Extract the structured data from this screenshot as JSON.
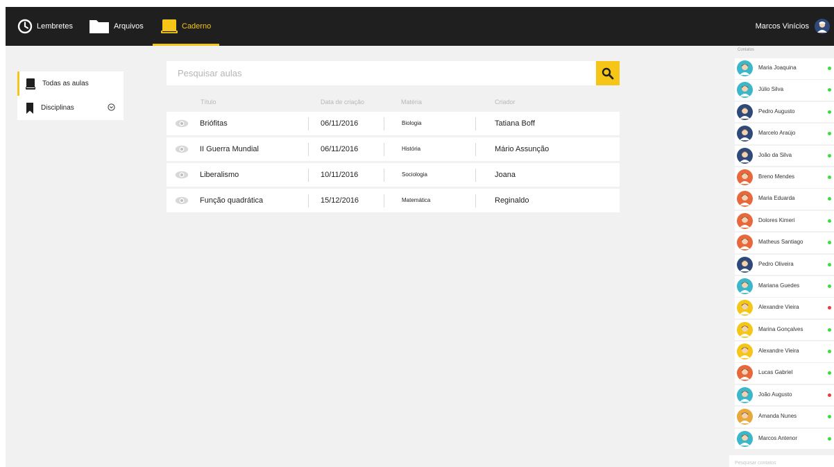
{
  "nav": {
    "items": [
      {
        "label": "Lembretes",
        "icon": "clock-icon"
      },
      {
        "label": "Arquivos",
        "icon": "folder-icon"
      },
      {
        "label": "Caderno",
        "icon": "notebook-icon"
      }
    ],
    "active": "Caderno",
    "accent": "#f5c518"
  },
  "user": {
    "name": "Marcos Vinícios",
    "icon": "avatar"
  },
  "menu": {
    "items": [
      {
        "label": "Todas as aulas",
        "icon": "book-icon",
        "active": true
      },
      {
        "label": "Disciplinas",
        "icon": "bookmark-icon",
        "active": false
      }
    ]
  },
  "search": {
    "placeholder": "Pesquisar aulas",
    "icon": "search-icon"
  },
  "table": {
    "columns": [
      "Título",
      "Data de criação",
      "Matéria",
      "Criador"
    ],
    "rows": [
      {
        "titulo": "Briófitas",
        "data": "06/11/2016",
        "materia": "Biologia",
        "criador": "Tatiana Boff"
      },
      {
        "titulo": "II Guerra Mundial",
        "data": "06/11/2016",
        "materia": "História",
        "criador": "Mário Assunção"
      },
      {
        "titulo": "Liberalismo",
        "data": "10/11/2016",
        "materia": "Sociologia",
        "criador": "Joana"
      },
      {
        "titulo": "Função quadrática",
        "data": "15/12/2016",
        "materia": "Matemática",
        "criador": "Reginaldo"
      }
    ]
  },
  "contacts": {
    "title": "Contatos",
    "search_placeholder": "Pesquisar contatos",
    "items": [
      {
        "name": "Maria Joaquina",
        "status": "online",
        "bg": "#3bb7c9"
      },
      {
        "name": "Júlio Silva",
        "status": "online",
        "bg": "#3bb7c9"
      },
      {
        "name": "Pedro Augusto",
        "status": "online",
        "bg": "#2f4a7a"
      },
      {
        "name": "Marcelo Araújo",
        "status": "online",
        "bg": "#2f4a7a"
      },
      {
        "name": "João da Silva",
        "status": "online",
        "bg": "#2f4a7a"
      },
      {
        "name": "Breno Mendes",
        "status": "online",
        "bg": "#e8683c"
      },
      {
        "name": "Maria Eduarda",
        "status": "online",
        "bg": "#e8683c"
      },
      {
        "name": "Dolores Kimeri",
        "status": "online",
        "bg": "#e8683c"
      },
      {
        "name": "Matheus Santiago",
        "status": "online",
        "bg": "#e8683c"
      },
      {
        "name": "Pedro Oliveira",
        "status": "online",
        "bg": "#2f4a7a"
      },
      {
        "name": "Mariana Guedes",
        "status": "online",
        "bg": "#3bb7c9"
      },
      {
        "name": "Alexandre Vieira",
        "status": "offline",
        "bg": "#f5c518"
      },
      {
        "name": "Marina Gonçalves",
        "status": "online",
        "bg": "#f5c518"
      },
      {
        "name": "Alexandre Vieira",
        "status": "online",
        "bg": "#f5c518"
      },
      {
        "name": "Lucas Gabriel",
        "status": "online",
        "bg": "#e8683c"
      },
      {
        "name": "João Augusto",
        "status": "offline",
        "bg": "#3bb7c9"
      },
      {
        "name": "Amanda Nunes",
        "status": "online",
        "bg": "#e8a83c"
      },
      {
        "name": "Marcos Antenor",
        "status": "online",
        "bg": "#3bb7c9"
      }
    ],
    "status_colors": {
      "online": "#3ddc3d",
      "offline": "#e83a3a"
    }
  }
}
